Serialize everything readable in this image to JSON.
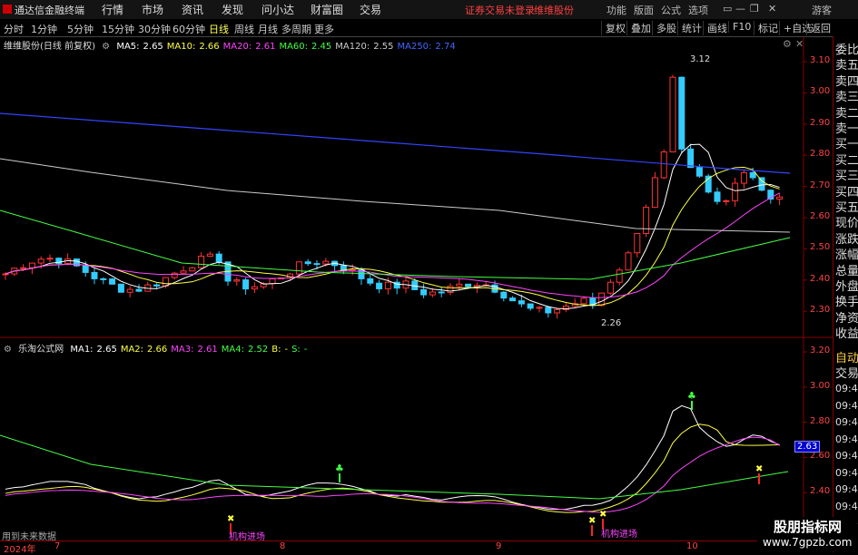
{
  "app": {
    "title": "通达信金融终端",
    "menus": [
      "行情",
      "市场",
      "资讯",
      "发现",
      "问小达",
      "财富圈",
      "交易"
    ],
    "warning": "证券交易未登录",
    "stock_name": "维维股份",
    "right_menus": [
      "功能",
      "版面",
      "公式",
      "选项"
    ],
    "guest": "游客"
  },
  "toolbar": {
    "periods": [
      "分时",
      "1分钟",
      "5分钟",
      "15分钟",
      "30分钟",
      "60分钟",
      "日线",
      "周线",
      "月线",
      "多周期",
      "更多"
    ],
    "active": "日线",
    "right": [
      "复权",
      "叠加",
      "多股",
      "统计",
      "画线",
      "F10",
      "标记",
      "+自选",
      "返回"
    ]
  },
  "main": {
    "legend_title": "维维股份(日线 前复权)",
    "ma": [
      {
        "label": "MA5:",
        "value": "2.65",
        "color": "#ffffff"
      },
      {
        "label": "MA10:",
        "value": "2.66",
        "color": "#ffff44"
      },
      {
        "label": "MA20:",
        "value": "2.61",
        "color": "#ff44ff"
      },
      {
        "label": "MA60:",
        "value": "2.45",
        "color": "#44ff44"
      },
      {
        "label": "MA120:",
        "value": "2.55",
        "color": "#cccccc"
      },
      {
        "label": "MA250:",
        "value": "2.74",
        "color": "#4466ff"
      }
    ],
    "y_ticks": [
      "3.10",
      "3.00",
      "2.90",
      "2.80",
      "2.70",
      "2.60",
      "2.50",
      "2.40",
      "2.30"
    ],
    "high_label": "3.12",
    "low_label": "2.26"
  },
  "sub": {
    "legend_title": "乐淘公式网",
    "ma": [
      {
        "label": "MA1:",
        "value": "2.65",
        "color": "#ffffff"
      },
      {
        "label": "MA2:",
        "value": "2.66",
        "color": "#ffff44"
      },
      {
        "label": "MA3:",
        "value": "2.61",
        "color": "#ff44ff"
      },
      {
        "label": "MA4:",
        "value": "2.52",
        "color": "#44ff44"
      },
      {
        "label": "B:",
        "value": "-",
        "color": "#ffff44"
      },
      {
        "label": "S:",
        "value": "-",
        "color": "#44ff44"
      }
    ],
    "y_ticks": [
      "3.20",
      "3.00",
      "2.80",
      "2.60",
      "2.40"
    ],
    "current": "2.63",
    "annotations": [
      "机构进场",
      "机构进场"
    ],
    "footer": "用到未来数据"
  },
  "xaxis": {
    "labels": [
      "2024年",
      "7",
      "8",
      "9",
      "10"
    ]
  },
  "right_panel": {
    "items": [
      "委比",
      "卖五",
      "卖四",
      "卖三",
      "卖二",
      "卖一",
      "买一",
      "买二",
      "买三",
      "买四",
      "买五",
      "现价",
      "涨跌",
      "涨幅",
      "总量",
      "外盘",
      "换手",
      "净资",
      "收益"
    ],
    "sub_items": [
      "自动",
      "交易"
    ],
    "times": [
      "09:45",
      "09:45",
      "09:45",
      "09:46",
      "09:46",
      "09:46",
      "09:46",
      "09:46",
      "09:46"
    ]
  },
  "watermark": {
    "line1": "股朋指标网",
    "line2": "www.7gpzb.com"
  }
}
